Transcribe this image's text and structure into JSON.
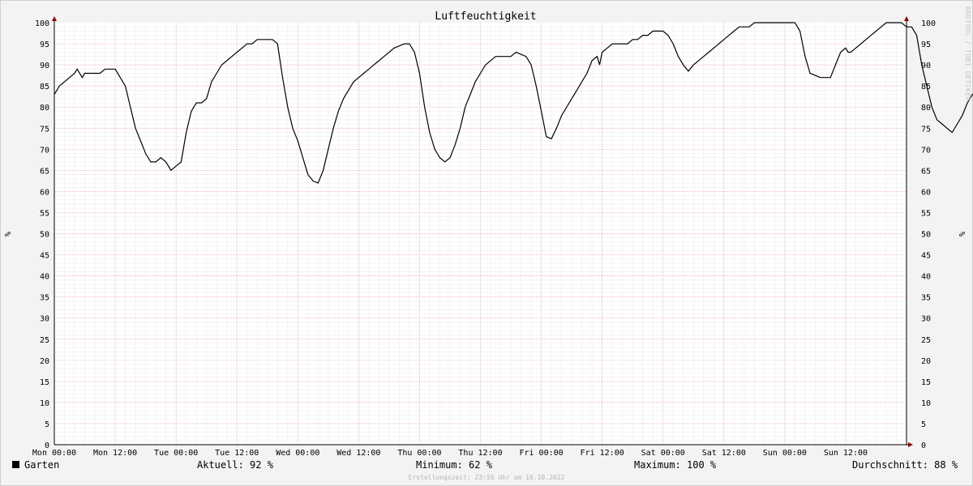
{
  "chart_data": {
    "type": "line",
    "title": "Luftfeuchtigkeit",
    "ylabel": "%",
    "ylim": [
      0,
      100
    ],
    "y_ticks": [
      0,
      5,
      10,
      15,
      20,
      25,
      30,
      35,
      40,
      45,
      50,
      55,
      60,
      65,
      70,
      75,
      80,
      85,
      90,
      95,
      100
    ],
    "x_ticks": [
      "Mon 00:00",
      "Mon 12:00",
      "Tue 00:00",
      "Tue 12:00",
      "Wed 00:00",
      "Wed 12:00",
      "Thu 00:00",
      "Thu 12:00",
      "Fri 00:00",
      "Fri 12:00",
      "Sat 00:00",
      "Sat 12:00",
      "Sun 00:00",
      "Sun 12:00"
    ],
    "x_unit": "hours since Mon 00:00",
    "xlim": [
      0,
      168
    ],
    "grid": true,
    "series": [
      {
        "name": "Garten",
        "color": "#000000",
        "points": [
          [
            0,
            83
          ],
          [
            1,
            85
          ],
          [
            2,
            86
          ],
          [
            3,
            87
          ],
          [
            4,
            88
          ],
          [
            4.5,
            89
          ],
          [
            5,
            88
          ],
          [
            5.5,
            87
          ],
          [
            6,
            88
          ],
          [
            7,
            88
          ],
          [
            9,
            88
          ],
          [
            10,
            89
          ],
          [
            12,
            89
          ],
          [
            13,
            87
          ],
          [
            14,
            85
          ],
          [
            15,
            80
          ],
          [
            16,
            75
          ],
          [
            17,
            72
          ],
          [
            18,
            69
          ],
          [
            19,
            67
          ],
          [
            20,
            67
          ],
          [
            21,
            68
          ],
          [
            22,
            67
          ],
          [
            23,
            65
          ],
          [
            24,
            66
          ],
          [
            25,
            67
          ],
          [
            26,
            74
          ],
          [
            27,
            79
          ],
          [
            28,
            81
          ],
          [
            29,
            81
          ],
          [
            30,
            82
          ],
          [
            31,
            86
          ],
          [
            32,
            88
          ],
          [
            33,
            90
          ],
          [
            34,
            91
          ],
          [
            35,
            92
          ],
          [
            36,
            93
          ],
          [
            37,
            94
          ],
          [
            38,
            95
          ],
          [
            39,
            95
          ],
          [
            40,
            96
          ],
          [
            43,
            96
          ],
          [
            44,
            95
          ],
          [
            45,
            87
          ],
          [
            46,
            80
          ],
          [
            47,
            75
          ],
          [
            48,
            72
          ],
          [
            49,
            68
          ],
          [
            50,
            64
          ],
          [
            51,
            62.5
          ],
          [
            52,
            62
          ],
          [
            53,
            65
          ],
          [
            54,
            70
          ],
          [
            55,
            75
          ],
          [
            56,
            79
          ],
          [
            57,
            82
          ],
          [
            58,
            84
          ],
          [
            59,
            86
          ],
          [
            60,
            87
          ],
          [
            61,
            88
          ],
          [
            62,
            89
          ],
          [
            63,
            90
          ],
          [
            64,
            91
          ],
          [
            65,
            92
          ],
          [
            66,
            93
          ],
          [
            67,
            94
          ],
          [
            68,
            94.5
          ],
          [
            69,
            95
          ],
          [
            70,
            95
          ],
          [
            71,
            93
          ],
          [
            72,
            88
          ],
          [
            73,
            80
          ],
          [
            74,
            74
          ],
          [
            75,
            70
          ],
          [
            76,
            68
          ],
          [
            77,
            67
          ],
          [
            78,
            68
          ],
          [
            79,
            71
          ],
          [
            80,
            75
          ],
          [
            81,
            80
          ],
          [
            82,
            83
          ],
          [
            83,
            86
          ],
          [
            84,
            88
          ],
          [
            85,
            90
          ],
          [
            86,
            91
          ],
          [
            87,
            92
          ],
          [
            90,
            92
          ],
          [
            91,
            93
          ],
          [
            92,
            92.5
          ],
          [
            93,
            92
          ],
          [
            94,
            90
          ],
          [
            95,
            85
          ],
          [
            96,
            79
          ],
          [
            97,
            73
          ],
          [
            98,
            72.5
          ],
          [
            99,
            75
          ],
          [
            100,
            78
          ],
          [
            101,
            80
          ],
          [
            102,
            82
          ],
          [
            103,
            84
          ],
          [
            104,
            86
          ],
          [
            105,
            88
          ],
          [
            106,
            91
          ],
          [
            107,
            92
          ],
          [
            107.5,
            90
          ],
          [
            108,
            93
          ],
          [
            109,
            94
          ],
          [
            110,
            95
          ],
          [
            113,
            95
          ],
          [
            114,
            96
          ],
          [
            115,
            96
          ],
          [
            116,
            97
          ],
          [
            117,
            97
          ],
          [
            118,
            98
          ],
          [
            120,
            98
          ],
          [
            121,
            97
          ],
          [
            122,
            95
          ],
          [
            123,
            92
          ],
          [
            124,
            90
          ],
          [
            125,
            88.5
          ],
          [
            126,
            90
          ],
          [
            127,
            91
          ],
          [
            128,
            92
          ],
          [
            129,
            93
          ],
          [
            130,
            94
          ],
          [
            131,
            95
          ],
          [
            132,
            96
          ],
          [
            133,
            97
          ],
          [
            134,
            98
          ],
          [
            135,
            99
          ],
          [
            137,
            99
          ],
          [
            138,
            100
          ],
          [
            146,
            100
          ],
          [
            147,
            98
          ],
          [
            148,
            92
          ],
          [
            149,
            88
          ],
          [
            150,
            87.5
          ],
          [
            151,
            87
          ],
          [
            152,
            87
          ],
          [
            153,
            87
          ],
          [
            154,
            90
          ],
          [
            155,
            93
          ],
          [
            156,
            94
          ],
          [
            156.5,
            93
          ],
          [
            157,
            93
          ],
          [
            158,
            94
          ],
          [
            159,
            95
          ],
          [
            160,
            96
          ],
          [
            161,
            97
          ],
          [
            162,
            98
          ],
          [
            163,
            99
          ],
          [
            164,
            100
          ],
          [
            167,
            100
          ],
          [
            168,
            99
          ],
          [
            169,
            99
          ],
          [
            170,
            97
          ],
          [
            171,
            90
          ],
          [
            172,
            85
          ],
          [
            173,
            80
          ],
          [
            174,
            77
          ],
          [
            175,
            76
          ],
          [
            176,
            75
          ],
          [
            177,
            74
          ],
          [
            178,
            76
          ],
          [
            179,
            78
          ],
          [
            180,
            81
          ],
          [
            181,
            83
          ],
          [
            182,
            84
          ],
          [
            183,
            86
          ],
          [
            184,
            88
          ],
          [
            185,
            90
          ],
          [
            186,
            92
          ]
        ]
      }
    ]
  },
  "legend": {
    "series_label": "Garten",
    "current": "Aktuell:  92 %",
    "minimum": "Minimum:  62 %",
    "maximum": "Maximum: 100 %",
    "average": "Durchschnitt:  88 %"
  },
  "footer": {
    "created": "Erstellungszeit: 23:55 Uhr am 16.10.2022"
  },
  "watermark": "RRDTOOL / TOBI OETIKER"
}
